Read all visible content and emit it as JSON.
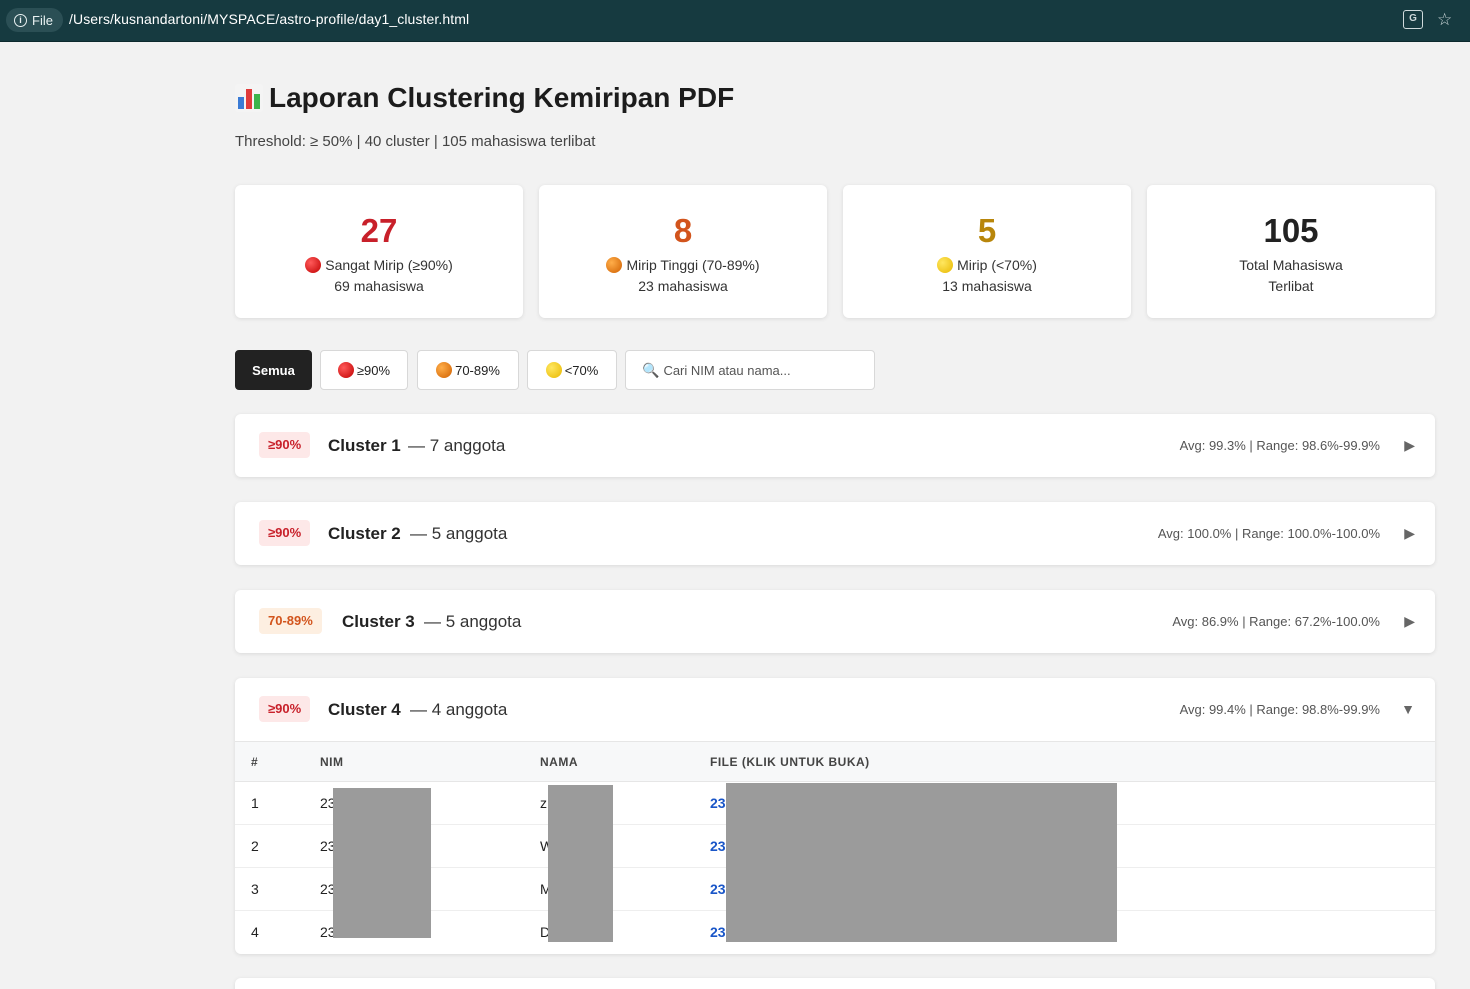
{
  "browser": {
    "file_label": "File",
    "url": "/Users/kusnandartoni/MYSPACE/astro-profile/day1_cluster.html"
  },
  "header": {
    "title": "Laporan Clustering Kemiripan PDF",
    "subtitle": "Threshold: ≥ 50% | 40 cluster | 105 mahasiswa terlibat"
  },
  "stats": [
    {
      "value": "27",
      "label": "Sangat Mirip (≥90%)",
      "sub": "69 mahasiswa",
      "color": "#c8202a",
      "dot": "red"
    },
    {
      "value": "8",
      "label": "Mirip Tinggi (70-89%)",
      "sub": "23 mahasiswa",
      "color": "#d2541c",
      "dot": "orange"
    },
    {
      "value": "5",
      "label": "Mirip (<70%)",
      "sub": "13 mahasiswa",
      "color": "#b8860b",
      "dot": "yellow"
    },
    {
      "value": "105",
      "label": "Total Mahasiswa",
      "sub": "Terlibat",
      "color": "#222222",
      "dot": ""
    }
  ],
  "filters": {
    "all": "Semua",
    "high": "≥90%",
    "mid": "70-89%",
    "low": "<70%",
    "search_placeholder": "Cari NIM atau nama..."
  },
  "clusters": [
    {
      "badge": "≥90%",
      "name": "Cluster 1",
      "count": "— 7 anggota",
      "stats": "Avg: 99.3% | Range: 98.6%-99.9%",
      "caret": "▶"
    },
    {
      "badge": "≥90%",
      "name": "Cluster 2",
      "count": "— 5 anggota",
      "stats": "Avg: 100.0% | Range: 100.0%-100.0%",
      "caret": "▶"
    },
    {
      "badge": "70-89%",
      "name": "Cluster 3",
      "count": "— 5 anggota",
      "stats": "Avg: 86.9% | Range: 67.2%-100.0%",
      "caret": "▶"
    },
    {
      "badge": "≥90%",
      "name": "Cluster 4",
      "count": "— 4 anggota",
      "stats": "Avg: 99.4% | Range: 98.8%-99.9%",
      "caret": "▼"
    }
  ],
  "table": {
    "headers": [
      "#",
      "NIM",
      "NAMA",
      "FILE (KLIK UNTUK BUKA)"
    ],
    "rows": [
      {
        "no": "1",
        "nim": "23",
        "nama": "z",
        "file": "23"
      },
      {
        "no": "2",
        "nim": "23",
        "nama": "W",
        "file": "23"
      },
      {
        "no": "3",
        "nim": "23",
        "nama": "M",
        "file": "23"
      },
      {
        "no": "4",
        "nim": "23",
        "nama": "D",
        "file": "23"
      }
    ]
  }
}
